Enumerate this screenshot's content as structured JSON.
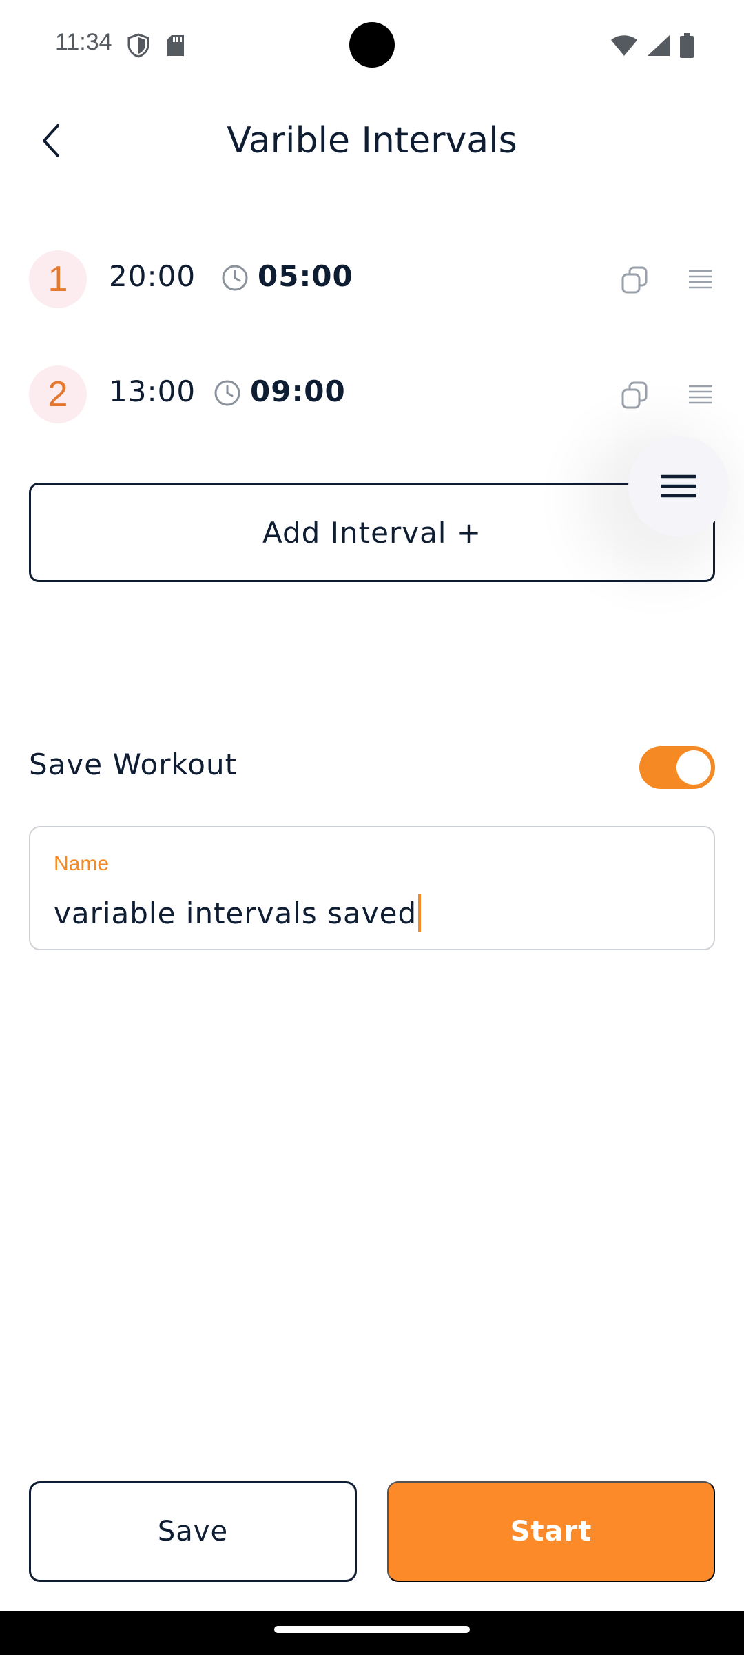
{
  "status_bar": {
    "time": "11:34",
    "left_icons": [
      "shield-icon",
      "sd-card-icon"
    ],
    "right_icons": [
      "wifi-icon",
      "signal-icon",
      "battery-icon"
    ]
  },
  "app_bar": {
    "title": "Varible Intervals",
    "back_icon": "chevron-left-icon"
  },
  "intervals": [
    {
      "number": "1",
      "work": "20:00",
      "rest": "05:00"
    },
    {
      "number": "2",
      "work": "13:00",
      "rest": "09:00"
    }
  ],
  "add_interval_label": "Add Interval +",
  "fab_icon": "menu-icon",
  "save_workout": {
    "label": "Save Workout",
    "enabled": true
  },
  "name_field": {
    "label": "Name",
    "value": "variable intervals saved"
  },
  "footer": {
    "save_label": "Save",
    "start_label": "Start"
  },
  "colors": {
    "accent": "#f58a25",
    "start_button": "#fd8a28",
    "text": "#0f1d33",
    "number_badge_bg": "#fdecef",
    "number_text": "#e4782e"
  }
}
